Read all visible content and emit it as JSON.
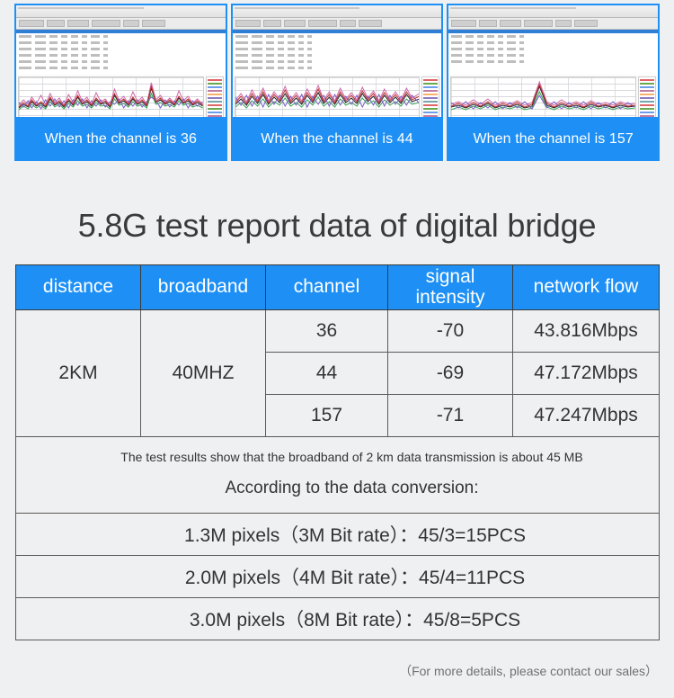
{
  "gallery": {
    "items": [
      {
        "caption": "When the channel is 36"
      },
      {
        "caption": "When the channel is 44"
      },
      {
        "caption": "When the channel is 157"
      }
    ]
  },
  "heading": "5.8G test report data of digital bridge",
  "table": {
    "headers": [
      "distance",
      "broadband",
      "channel",
      "signal\nintensity",
      "network flow"
    ],
    "header_signal_line1": "signal",
    "header_signal_line2": "intensity",
    "distance": "2KM",
    "broadband": "40MHZ",
    "rows": [
      {
        "channel": "36",
        "signal_intensity": "-70",
        "network_flow": "43.816Mbps"
      },
      {
        "channel": "44",
        "signal_intensity": "-69",
        "network_flow": "47.172Mbps"
      },
      {
        "channel": "157",
        "signal_intensity": "-71",
        "network_flow": "47.247Mbps"
      }
    ],
    "note_line1": "The test results show that the broadband of 2 km data transmission is about 45 MB",
    "note_line2": "According to the data conversion:",
    "calculations": [
      "1.3M pixels（3M Bit rate）：45/3=15PCS",
      "2.0M pixels（4M Bit rate）：45/4=11PCS",
      "3.0M pixels（8M Bit rate）：45/8=5PCS"
    ]
  },
  "footnote": "（For more details, please contact our sales）",
  "colors": {
    "accent": "#1e90f5",
    "note_text": "#3f95e8",
    "page_bg": "#eff0f1",
    "heading": "#3a3a3c"
  }
}
